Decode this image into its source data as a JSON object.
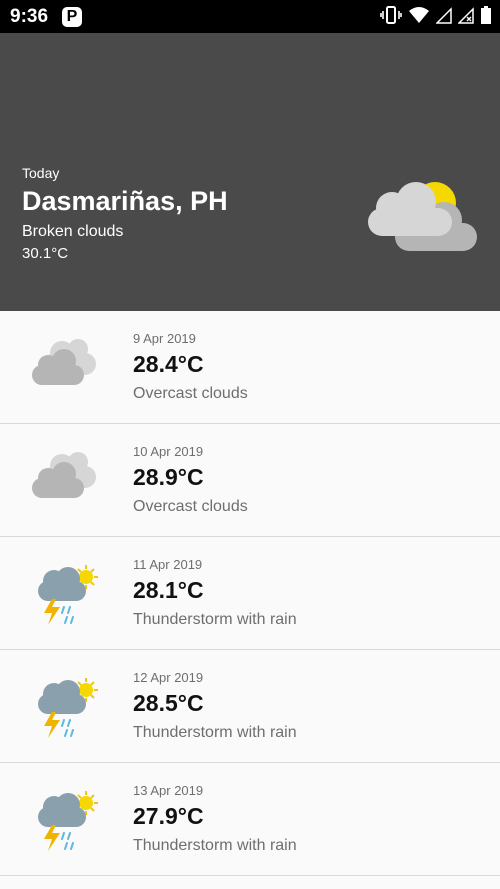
{
  "status_bar": {
    "time": "9:36",
    "app_badge": "P"
  },
  "today": {
    "label": "Today",
    "city": "Dasmariñas, PH",
    "description": "Broken clouds",
    "temperature": "30.1°C",
    "icon": "broken-clouds-icon"
  },
  "forecast": [
    {
      "date": "9 Apr 2019",
      "temp": "28.4°C",
      "desc": "Overcast clouds",
      "icon": "overcast-clouds-icon"
    },
    {
      "date": "10 Apr 2019",
      "temp": "28.9°C",
      "desc": "Overcast clouds",
      "icon": "overcast-clouds-icon"
    },
    {
      "date": "11 Apr 2019",
      "temp": "28.1°C",
      "desc": "Thunderstorm with rain",
      "icon": "thunderstorm-icon"
    },
    {
      "date": "12 Apr 2019",
      "temp": "28.5°C",
      "desc": "Thunderstorm with rain",
      "icon": "thunderstorm-icon"
    },
    {
      "date": "13 Apr 2019",
      "temp": "27.9°C",
      "desc": "Thunderstorm with rain",
      "icon": "thunderstorm-icon"
    }
  ],
  "colors": {
    "hero_bg": "#4a4a4a",
    "status_bg": "#000000",
    "list_bg": "#fafafa",
    "sun": "#f5d800",
    "cloud_light": "#d6d6d6",
    "cloud_dark": "#b5b5b5"
  }
}
